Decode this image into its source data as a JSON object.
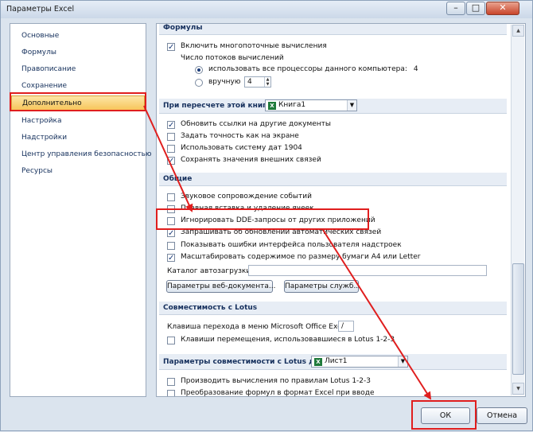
{
  "window": {
    "title": "Параметры Excel",
    "min_glyph": "–",
    "max_glyph": "□",
    "close_glyph": "✕"
  },
  "nav": {
    "items": [
      {
        "label": "Основные",
        "selected": false
      },
      {
        "label": "Формулы",
        "selected": false
      },
      {
        "label": "Правописание",
        "selected": false
      },
      {
        "label": "Сохранение",
        "selected": false
      },
      {
        "label": "Дополнительно",
        "selected": true
      },
      {
        "label": "Настройка",
        "selected": false
      },
      {
        "label": "Надстройки",
        "selected": false
      },
      {
        "label": "Центр управления безопасностью",
        "selected": false
      },
      {
        "label": "Ресурсы",
        "selected": false
      }
    ]
  },
  "formulas": {
    "header": "Формулы",
    "multithread": {
      "label": "Включить многопоточные вычисления",
      "checked": true
    },
    "threads_label": "Число потоков вычислений",
    "use_all": {
      "label": "использовать все процессоры данного компьютера:",
      "value": "4",
      "selected": true
    },
    "manual": {
      "label": "вручную",
      "value": "4",
      "selected": false
    }
  },
  "recalc": {
    "header": "При пересчете этой книги:",
    "workbook": "Книга1",
    "options": [
      {
        "label": "Обновить ссылки на другие документы",
        "checked": true
      },
      {
        "label": "Задать точность как на экране",
        "checked": false
      },
      {
        "label": "Использовать систему дат 1904",
        "checked": false
      },
      {
        "label": "Сохранять значения внешних связей",
        "checked": true
      }
    ]
  },
  "general": {
    "header": "Общие",
    "options": [
      {
        "label": "Звуковое сопровождение событий",
        "checked": false
      },
      {
        "label": "Плавная вставка и удаление ячеек",
        "checked": false
      },
      {
        "label": "Игнорировать DDE-запросы от других приложений",
        "checked": false
      },
      {
        "label": "Запрашивать об обновлении автоматических связей",
        "checked": true
      },
      {
        "label": "Показывать ошибки интерфейса пользователя надстроек",
        "checked": false
      },
      {
        "label": "Масштабировать содержимое по размеру бумаги A4 или Letter",
        "checked": true
      }
    ],
    "autoload_label": "Каталог автозагрузки:",
    "autoload_value": "",
    "web_button": "Параметры веб-документа...",
    "services_button": "Параметры служб..."
  },
  "lotus": {
    "header": "Совместимость с Lotus",
    "menu_key_label": "Клавиша перехода в меню Microsoft Office Excel:",
    "menu_key_value": "/",
    "nav_keys": {
      "label": "Клавиши перемещения, использовавшиеся в Lotus 1-2-3",
      "checked": false
    }
  },
  "lotus_settings": {
    "header": "Параметры совместимости с Lotus для:",
    "sheet": "Лист1",
    "options": [
      {
        "label": "Производить вычисления по правилам Lotus 1-2-3",
        "checked": false
      },
      {
        "label": "Преобразование формул в формат Excel при вводе",
        "checked": false
      }
    ]
  },
  "footer": {
    "ok": "ОК",
    "cancel": "Отмена"
  },
  "colors": {
    "annotation_red": "#e01e1e",
    "selected_nav": "#f7c65b"
  }
}
